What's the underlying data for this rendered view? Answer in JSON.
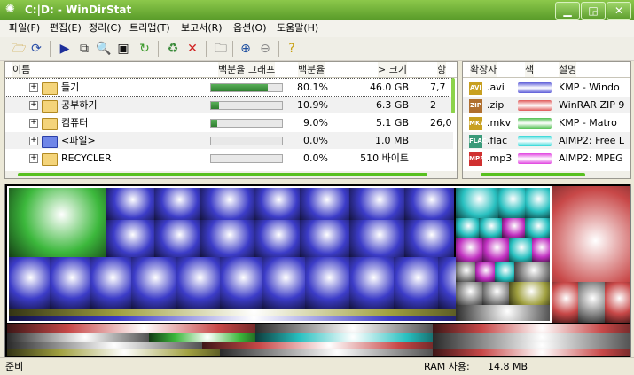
{
  "window": {
    "title": "C:|D: - WinDirStat"
  },
  "menu": [
    "파일(F)",
    "편집(E)",
    "정리(C)",
    "트리맵(T)",
    "보고서(R)",
    "옵션(O)",
    "도움말(H)"
  ],
  "toolbar": {
    "icons": [
      "open-folder-icon",
      "refresh-icon",
      "play-icon",
      "copy-icon",
      "explorer-icon",
      "command-prompt-icon",
      "refresh-green-icon",
      "recycle-bin-icon",
      "delete-icon",
      "new-folder-icon",
      "zoom-in-icon",
      "zoom-out-icon",
      "help-icon"
    ]
  },
  "dirtree": {
    "columns": {
      "name": "이름",
      "graph": "백분율 그래프",
      "percent": "백분율",
      "size": "> 크기",
      "items": "항"
    },
    "rows": [
      {
        "name": "들기",
        "percent_value": 80.1,
        "percent": "80.1%",
        "size": "46.0 GB",
        "items": "7,7"
      },
      {
        "name": "공부하기",
        "percent_value": 10.9,
        "percent": "10.9%",
        "size": "6.3 GB",
        "items": "2"
      },
      {
        "name": "컴퓨터",
        "percent_value": 9.0,
        "percent": "9.0%",
        "size": "5.1 GB",
        "items": "26,0"
      },
      {
        "name": "<파일>",
        "percent_value": 0.0,
        "percent": "0.0%",
        "size": "1.0 MB",
        "items": ""
      },
      {
        "name": "RECYCLER",
        "percent_value": 0.0,
        "percent": "0.0%",
        "size": "510 바이트",
        "items": ""
      }
    ]
  },
  "extlist": {
    "columns": {
      "ext": "확장자",
      "color": "색",
      "desc": "설명"
    },
    "rows": [
      {
        "ext": ".avi",
        "color": "#5a5ad8",
        "desc": "KMP - Windo",
        "icon": "AVI",
        "icon_color": "#c8a020"
      },
      {
        "ext": ".zip",
        "color": "#e05858",
        "desc": "WinRAR ZIP 9",
        "icon": "ZIP",
        "icon_color": "#b07030"
      },
      {
        "ext": ".mkv",
        "color": "#50c050",
        "desc": "KMP - Matro",
        "icon": "MKV",
        "icon_color": "#c8a020"
      },
      {
        "ext": ".flac",
        "color": "#30d8d8",
        "desc": "AIMP2: Free L",
        "icon": "FLAC",
        "icon_color": "#3a9a7a"
      },
      {
        "ext": ".mp3",
        "color": "#e040e0",
        "desc": "AIMP2: MPEG",
        "icon": "MP3",
        "icon_color": "#d03030"
      }
    ]
  },
  "status": {
    "ready": "준비",
    "ram_label": "RAM 사용:",
    "ram_value": "14.8 MB"
  }
}
